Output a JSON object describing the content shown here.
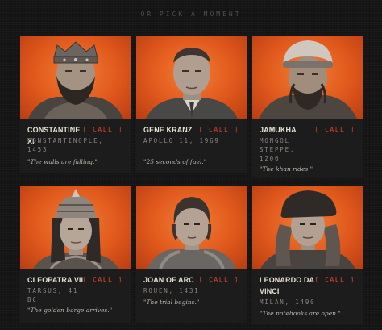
{
  "heading": "OR PICK A MOMENT",
  "call_label": "[ CALL ]",
  "cards": [
    {
      "name": "CONSTANTINE XI",
      "place": "CONSTANTINOPLE, 1453",
      "quote": "\"The walls are falling.\""
    },
    {
      "name": "GENE KRANZ",
      "place": "APOLLO 11, 1969",
      "quote": "\"25 seconds of fuel.\""
    },
    {
      "name": "JAMUKHA",
      "place": "MONGOL STEPPE, 1206",
      "quote": "\"The khan rides.\""
    },
    {
      "name": "CLEOPATRA VII",
      "place": "TARSUS, 41 BC",
      "quote": "\"The golden barge arrives.\""
    },
    {
      "name": "JOAN OF ARC",
      "place": "ROUEN, 1431",
      "quote": "\"The trial begins.\""
    },
    {
      "name": "LEONARDO DA VINCI",
      "place": "MILAN, 1490",
      "quote": "\"The notebooks are open.\""
    }
  ]
}
